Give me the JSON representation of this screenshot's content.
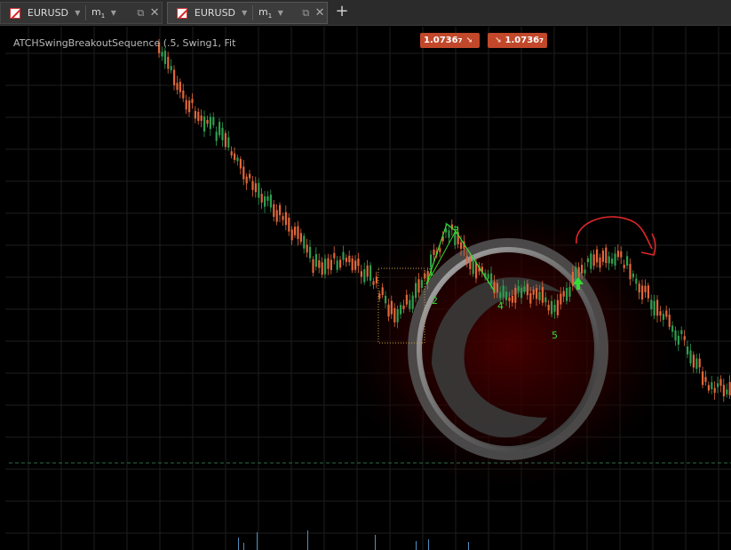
{
  "tabs": [
    {
      "symbol": "EURUSD",
      "timeframe": "m",
      "timeframe_sub": "1"
    },
    {
      "symbol": "EURUSD",
      "timeframe": "m",
      "timeframe_sub": "1"
    }
  ],
  "chart": {
    "indicator_label": "ATCHSwingBreakoutSequence (.5, Swing1, Fit",
    "bid_tag": {
      "price": "1.0736",
      "sup": "7"
    },
    "ask_tag": {
      "price": "1.0736",
      "sup": "7"
    },
    "pattern_labels": [
      "1",
      "2",
      "3",
      "4",
      "5"
    ],
    "colors": {
      "bull": "#2e9e4f",
      "bear": "#e0673a",
      "pattern": "#33dd33",
      "tag": "#c1482a",
      "annotation": "#e0272a",
      "grid": "#1e1e1e"
    }
  },
  "icons": {
    "symbol_flag": "instrument-flag-icon",
    "detach": "detach-icon",
    "close": "close-icon",
    "new_tab": "plus-icon",
    "dropdown": "chevron-down-icon"
  }
}
